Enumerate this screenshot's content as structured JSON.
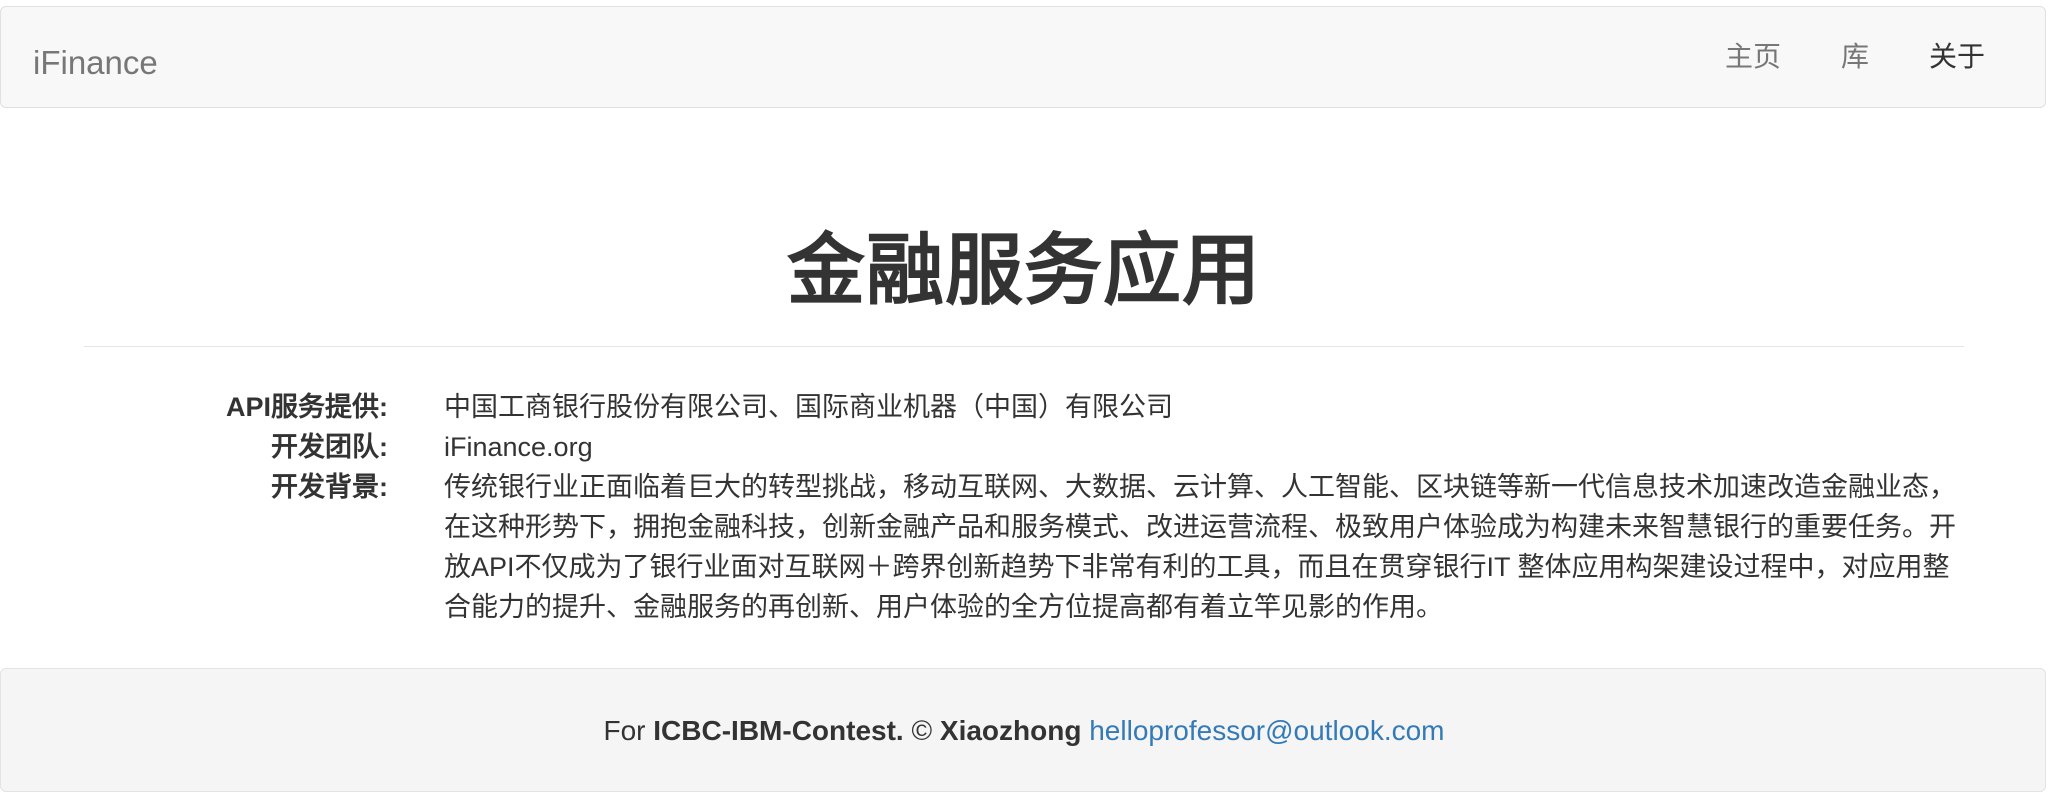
{
  "navbar": {
    "brand": "iFinance",
    "items": [
      {
        "label": "主页"
      },
      {
        "label": "库"
      },
      {
        "label": "关于"
      }
    ]
  },
  "main": {
    "title": "金融服务应用",
    "info": [
      {
        "term": "API服务提供:",
        "desc": "中国工商银行股份有限公司、国际商业机器（中国）有限公司"
      },
      {
        "term": "开发团队:",
        "desc": "iFinance.org"
      },
      {
        "term": "开发背景:",
        "desc": "传统银行业正面临着巨大的转型挑战，移动互联网、大数据、云计算、人工智能、区块链等新一代信息技术加速改造金融业态，在这种形势下，拥抱金融科技，创新金融产品和服务模式、改进运营流程、极致用户体验成为构建未来智慧银行的重要任务。开放API不仅成为了银行业面对互联网＋跨界创新趋势下非常有利的工具，而且在贯穿银行IT 整体应用构架建设过程中，对应用整合能力的提升、金融服务的再创新、用户体验的全方位提高都有着立竿见影的作用。"
      }
    ]
  },
  "footer": {
    "prefix": "For ",
    "contest": "ICBC-IBM-Contest.",
    "copyright": " © ",
    "author": "Xiaozhong",
    "space": " ",
    "email": "helloprofessor@outlook.com"
  },
  "colors": {
    "navbar_bg": "#f8f8f8",
    "link": "#337ab7",
    "text": "#333333",
    "muted": "#777777"
  }
}
